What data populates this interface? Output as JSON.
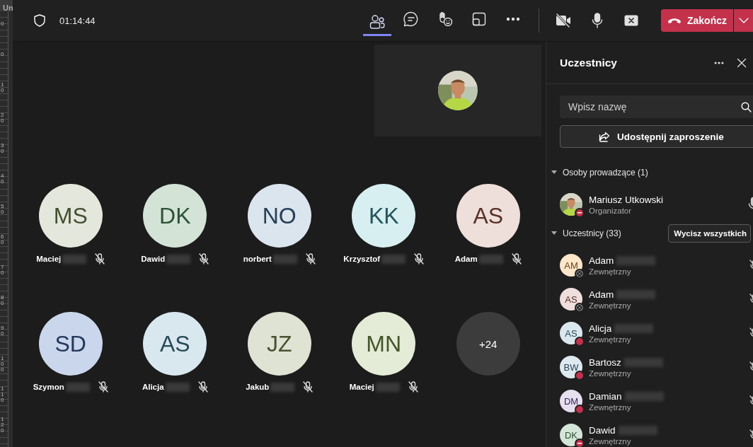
{
  "background_app": {
    "tab": "Un",
    "ruler_labels": [
      "0",
      "0",
      "10",
      "20",
      "30",
      "40",
      "50",
      "60",
      "70",
      "80",
      "90",
      "100",
      "110",
      "120"
    ]
  },
  "top_bar": {
    "timer": "01:14:44",
    "tools": [
      {
        "kind": "people",
        "selected": true
      },
      {
        "kind": "chat",
        "selected": false
      },
      {
        "kind": "react",
        "selected": false
      },
      {
        "kind": "view",
        "selected": false
      },
      {
        "kind": "more",
        "selected": false
      }
    ],
    "controls": [
      {
        "kind": "camera-off"
      },
      {
        "kind": "mic"
      },
      {
        "kind": "share-stop"
      }
    ],
    "end_button": {
      "label": "Zakończ"
    }
  },
  "stage": {
    "tiles": [
      {
        "kind": "person",
        "initials": "MS",
        "name": "Maciej",
        "color": "#e3e7dc",
        "muted": true,
        "redacted": true
      },
      {
        "kind": "person",
        "initials": "DK",
        "name": "Dawid",
        "color": "#d3e4d7",
        "muted": true,
        "redacted": true
      },
      {
        "kind": "person",
        "initials": "NO",
        "name": "norbert",
        "color": "#dbe5ee",
        "muted": true,
        "redacted": true
      },
      {
        "kind": "person",
        "initials": "KK",
        "name": "Krzysztof",
        "color": "#d8eff2",
        "muted": true,
        "redacted": true
      },
      {
        "kind": "person",
        "initials": "AS",
        "name": "Adam",
        "color": "#efdfdb",
        "muted": true,
        "redacted": true
      },
      {
        "kind": "person",
        "initials": "SD",
        "name": "Szymon",
        "color": "#c9d6ec",
        "muted": true,
        "redacted": true
      },
      {
        "kind": "person",
        "initials": "AS",
        "name": "Alicja",
        "color": "#d9e8ee",
        "muted": true,
        "redacted": true
      },
      {
        "kind": "person",
        "initials": "JZ",
        "name": "Jakub",
        "color": "#dfe3d4",
        "muted": true,
        "redacted": true
      },
      {
        "kind": "person",
        "initials": "MN",
        "name": "Maciej",
        "color": "#e4ecd8",
        "muted": true,
        "redacted": true
      },
      {
        "kind": "overflow",
        "label": "+24"
      }
    ]
  },
  "panel": {
    "title": "Uczestnicy",
    "search": {
      "placeholder": "Wpisz nazwę"
    },
    "invite_button": "Udostępnij zaproszenie",
    "sections": [
      {
        "title": "Osoby prowadzące (1)",
        "expanded": true,
        "people": [
          {
            "name": "Mariusz Utkowski",
            "redacted": false,
            "role": "Organizator",
            "offline": false,
            "dnd": true,
            "muted": false
          }
        ]
      },
      {
        "title": "Uczestnicy (33)",
        "expanded": true,
        "action": "Wycisz wszystkich",
        "people": [
          {
            "kind": "initials",
            "initials": "AM",
            "color": "#fde6c9",
            "name": "Adam",
            "redacted": true,
            "role": "Zewnętrzny",
            "offline": true,
            "dnd": false,
            "muted": true
          },
          {
            "kind": "initials",
            "initials": "AS",
            "color": "#efdfdc",
            "name": "Adam",
            "redacted": true,
            "role": "Zewnętrzny",
            "offline": true,
            "dnd": false,
            "muted": true
          },
          {
            "kind": "initials",
            "initials": "AS",
            "color": "#dae8ee",
            "name": "Alicja",
            "redacted": true,
            "role": "Zewnętrzny",
            "offline": false,
            "dnd": false,
            "muted": true
          },
          {
            "kind": "initials",
            "initials": "BW",
            "color": "#dde8ef",
            "name": "Bartosz",
            "redacted": true,
            "role": "Zewnętrzny",
            "offline": false,
            "dnd": false,
            "muted": true
          },
          {
            "kind": "initials",
            "initials": "DM",
            "color": "#e5dff0",
            "name": "Damian",
            "redacted": true,
            "role": "Zewnętrzny",
            "offline": false,
            "dnd": false,
            "muted": true
          },
          {
            "kind": "initials",
            "initials": "DK",
            "color": "#d4e6d8",
            "name": "Dawid",
            "redacted": true,
            "role": "Zewnętrzny",
            "offline": false,
            "dnd": true,
            "muted": true
          }
        ]
      }
    ]
  }
}
